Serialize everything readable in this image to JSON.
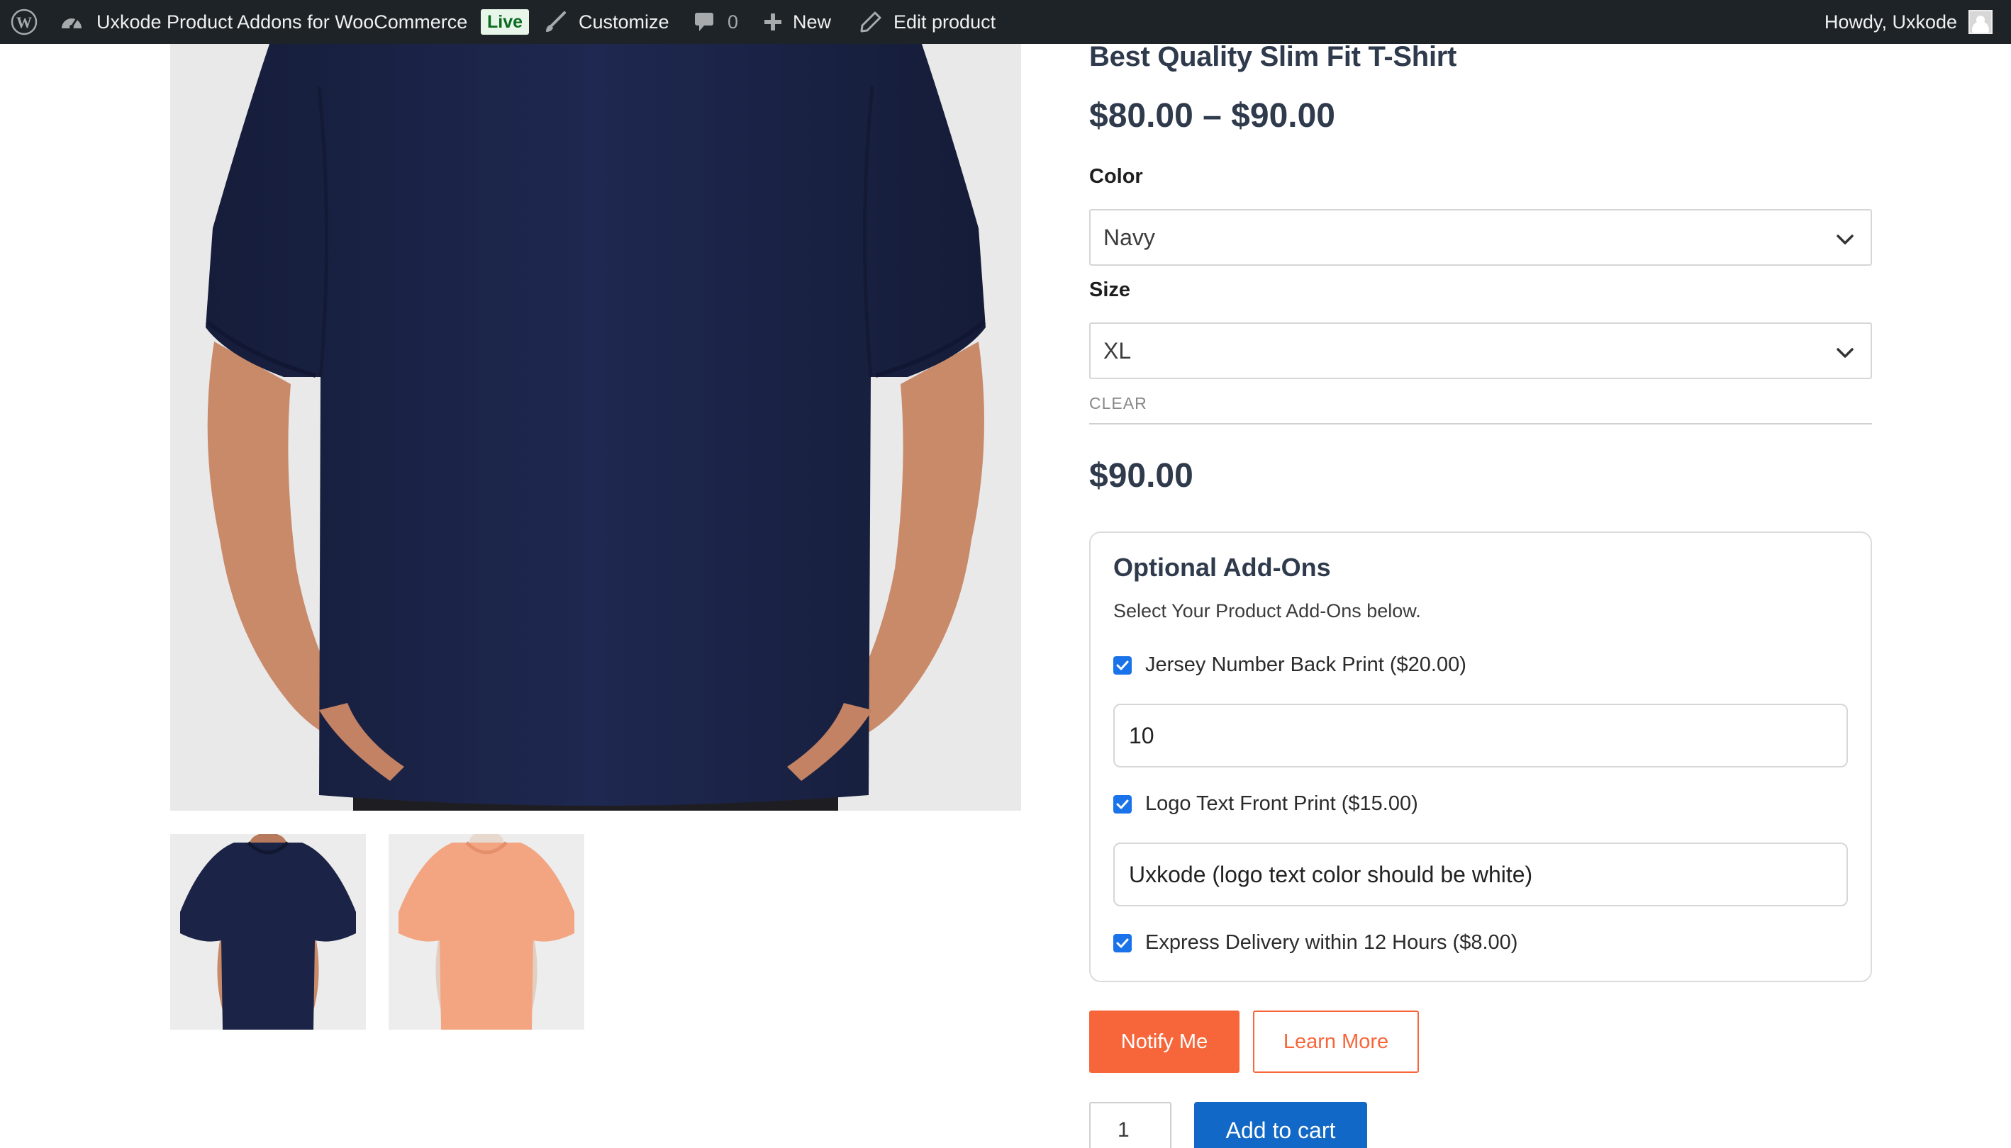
{
  "admin_bar": {
    "site_name": "Uxkode Product Addons for WooCommerce",
    "live_badge": "Live",
    "customize": "Customize",
    "comments_count": "0",
    "new": "New",
    "edit_product": "Edit product",
    "howdy": "Howdy, Uxkode"
  },
  "product": {
    "title": "Best Quality Slim Fit T-Shirt",
    "price_range": "$80.00 – $90.00",
    "attributes": [
      {
        "label": "Color",
        "selected": "Navy"
      },
      {
        "label": "Size",
        "selected": "XL"
      }
    ],
    "clear_link": "CLEAR",
    "variation_price": "$90.00"
  },
  "addons": {
    "title": "Optional Add-Ons",
    "description": "Select Your Product Add-Ons below.",
    "items": [
      {
        "label": "Jersey Number Back Print ($20.00)",
        "checked": true,
        "value": "10"
      },
      {
        "label": "Logo Text Front Print ($15.00)",
        "checked": true,
        "value": "Uxkode (logo text color should be white)"
      },
      {
        "label": "Express Delivery within 12 Hours ($8.00)",
        "checked": true
      }
    ]
  },
  "buttons": {
    "notify": "Notify Me",
    "learn_more": "Learn More",
    "add_to_cart": "Add to cart"
  },
  "quantity": "1",
  "colors": {
    "admin_bar_bg": "#1d2327",
    "accent_orange": "#f7663a",
    "primary_blue": "#1268c6",
    "checkbox_blue": "#1a73e8",
    "shirt_navy": "#1b2447",
    "shirt_peach": "#f3a582"
  },
  "icons": [
    "wordpress-logo-icon",
    "dashboard-icon",
    "customize-brush-icon",
    "comment-icon",
    "plus-icon",
    "pencil-icon",
    "chevron-down-icon",
    "checkmark-icon",
    "avatar-icon"
  ]
}
